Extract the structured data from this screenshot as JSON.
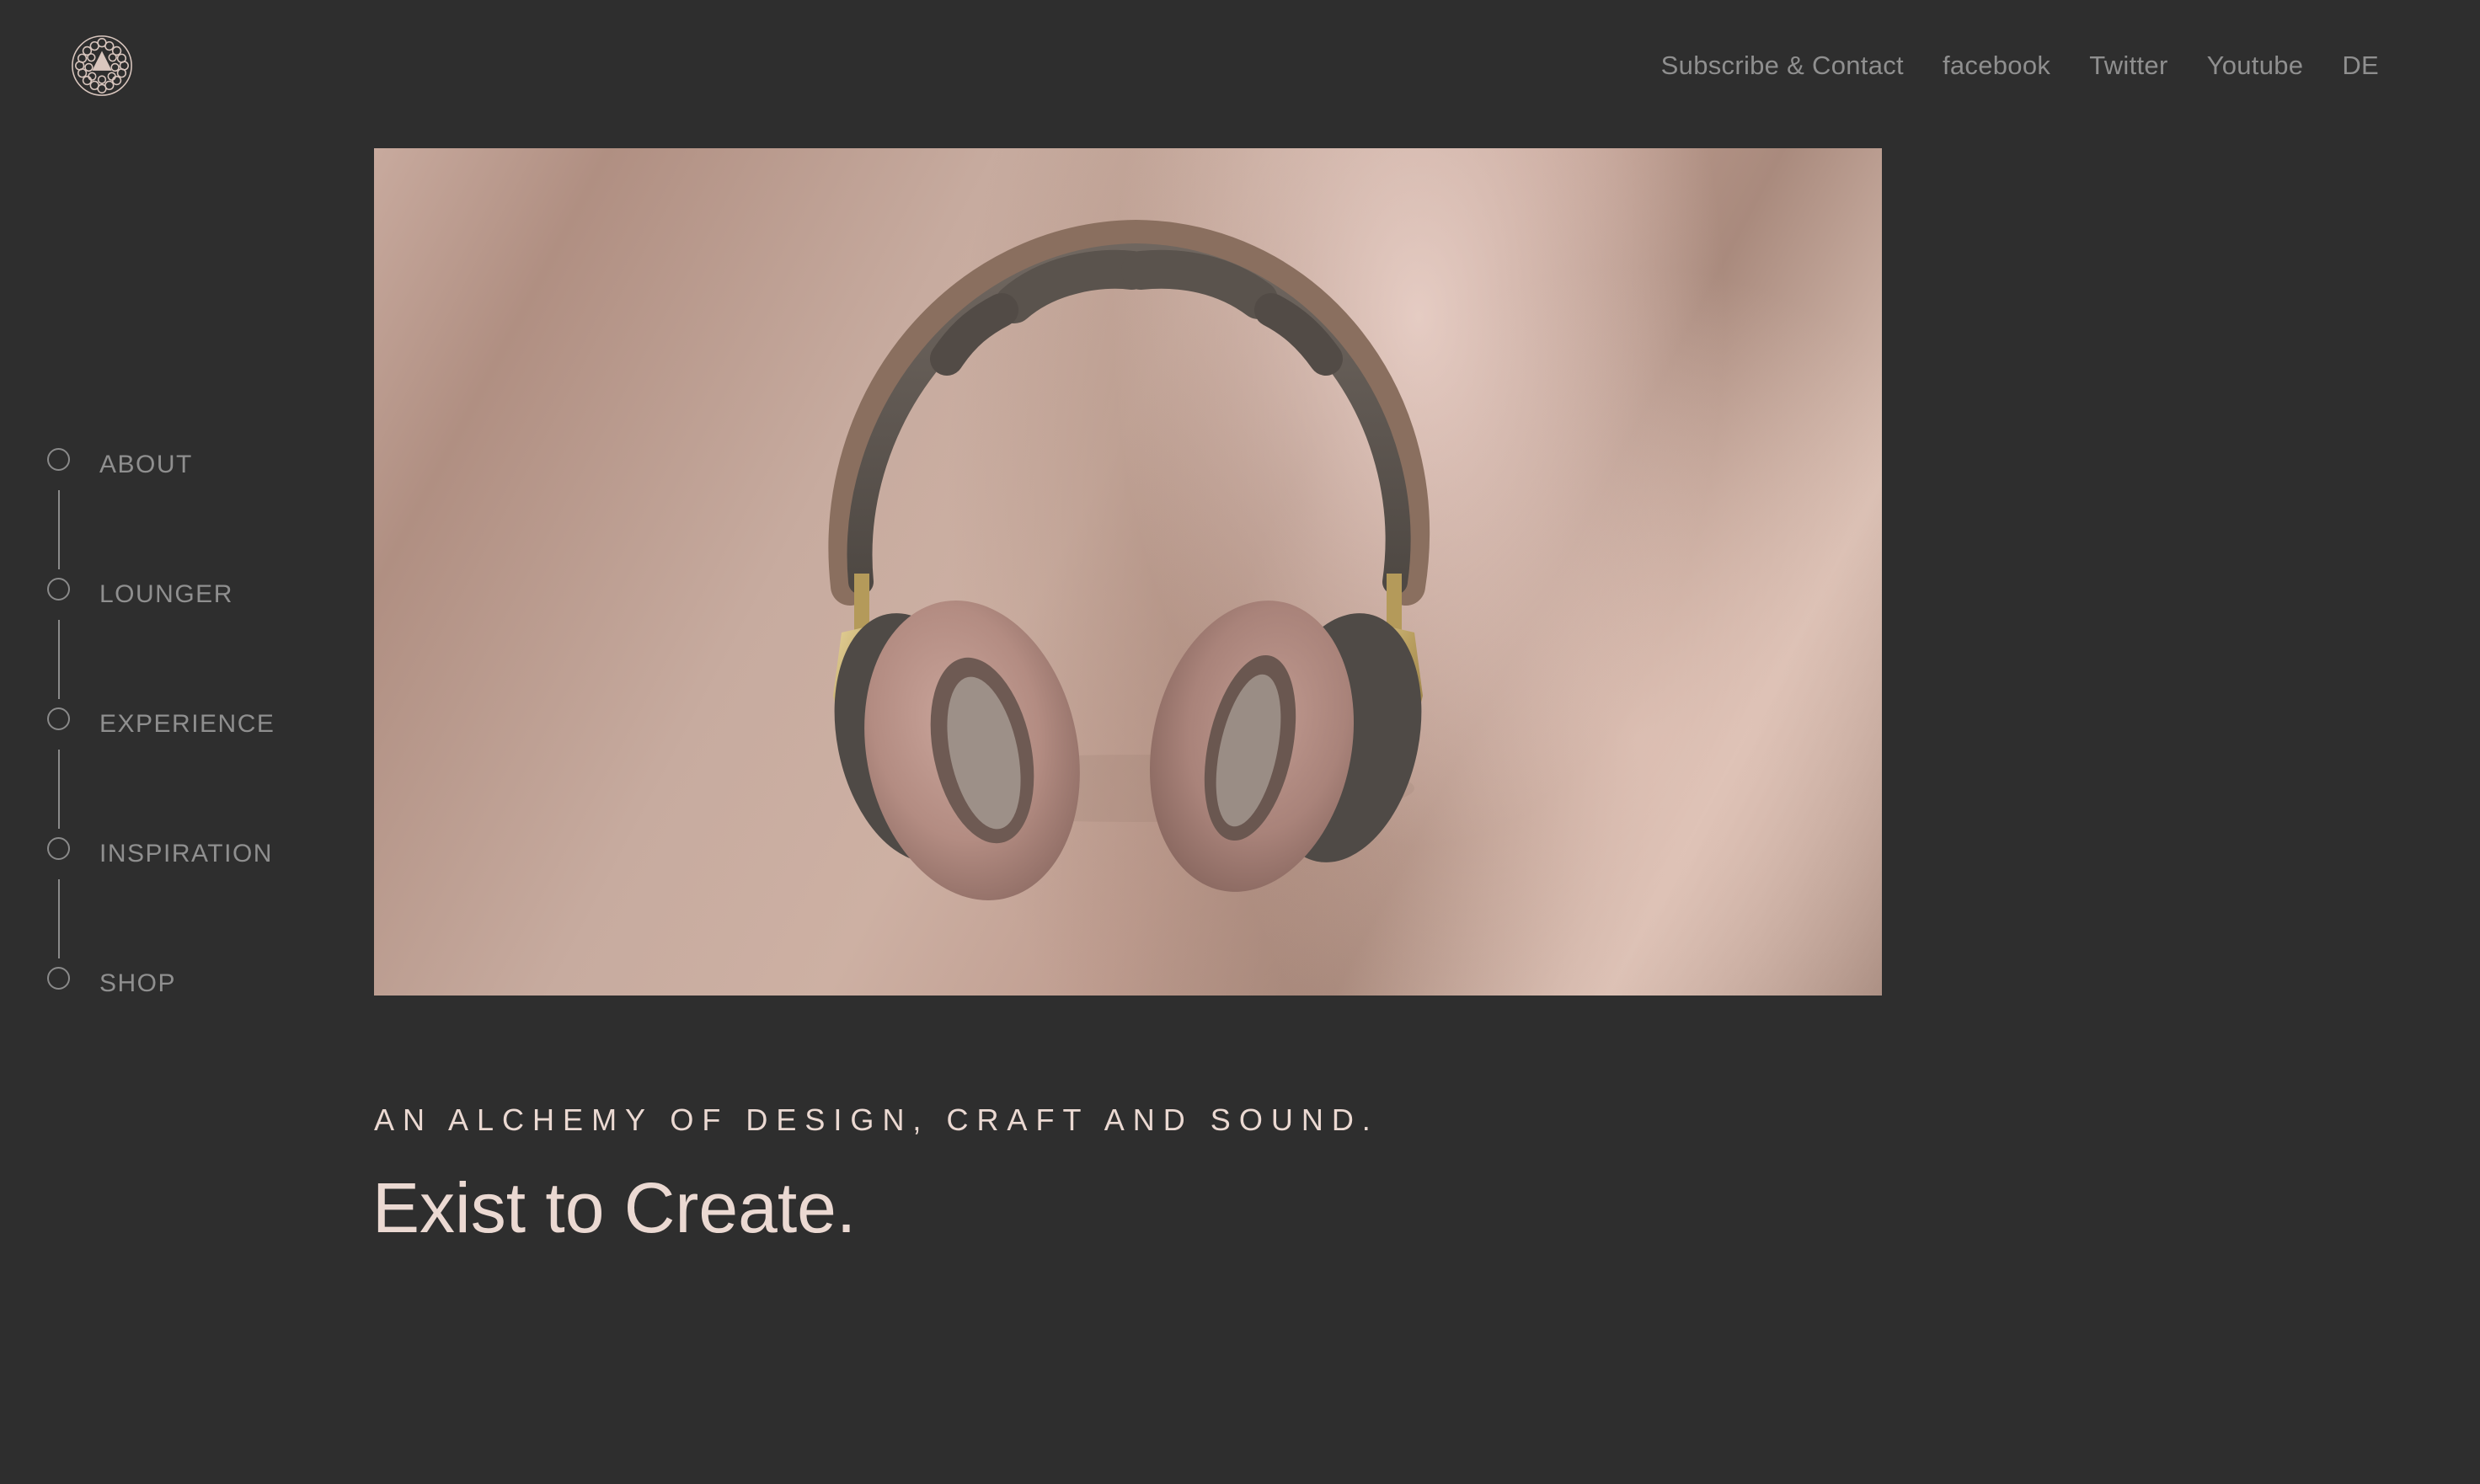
{
  "brand": {
    "logo_icon": "hexagon-pattern-logo",
    "accent_color": "#ebd9d2",
    "background_color": "#2e2e2e"
  },
  "topnav": {
    "items": [
      {
        "label": "Subscribe & Contact"
      },
      {
        "label": "facebook"
      },
      {
        "label": "Twitter"
      },
      {
        "label": "Youtube"
      },
      {
        "label": "DE"
      }
    ]
  },
  "sidenav": {
    "items": [
      {
        "label": "ABOUT"
      },
      {
        "label": "LOUNGER"
      },
      {
        "label": "EXPERIENCE"
      },
      {
        "label": "INSPIRATION"
      },
      {
        "label": "SHOP"
      }
    ]
  },
  "hero": {
    "image_subject": "headphones-image"
  },
  "intro": {
    "eyebrow": "AN ALCHEMY OF DESIGN, CRAFT AND SOUND.",
    "headline": "Exist to Create."
  }
}
